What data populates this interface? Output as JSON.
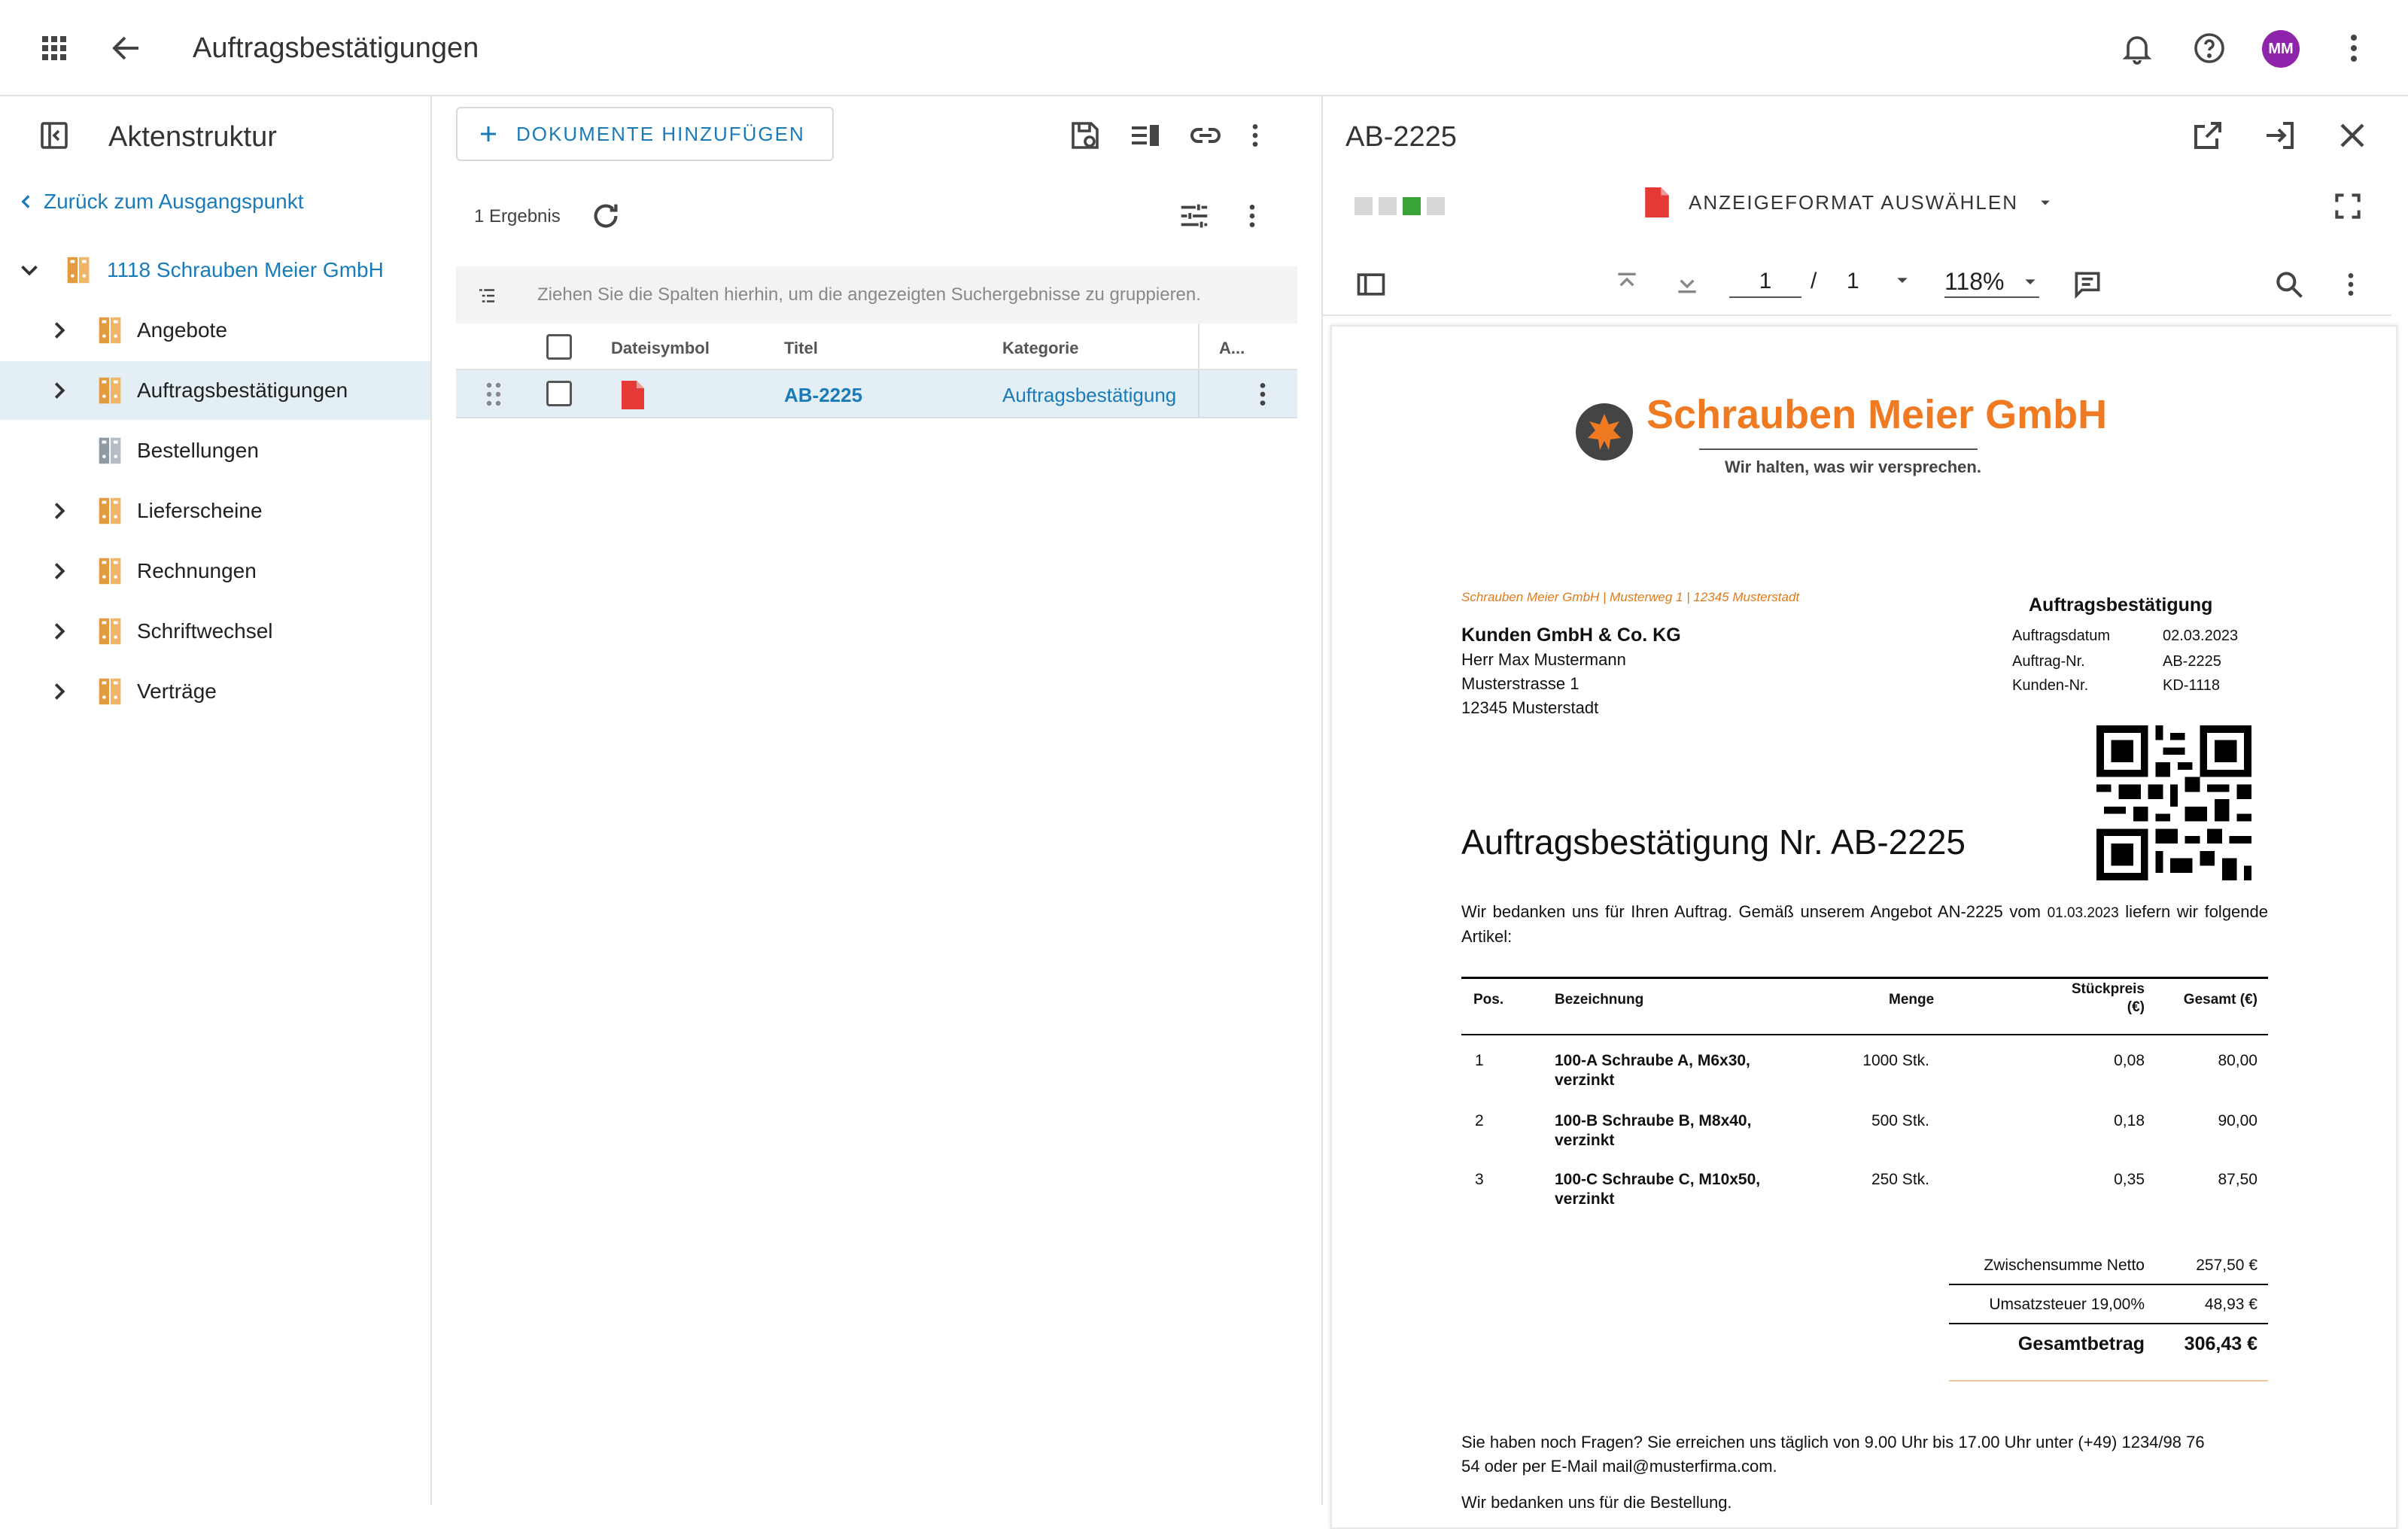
{
  "appbar": {
    "title": "Auftragsbestätigungen",
    "avatar": "MM",
    "avatar_color": "#8e24aa"
  },
  "sidebar": {
    "title": "Aktenstruktur",
    "back_link": "Zurück zum Ausgangspunkt",
    "root": "1118 Schrauben Meier GmbH",
    "items": [
      {
        "label": "Angebote",
        "expandable": true
      },
      {
        "label": "Auftragsbestätigungen",
        "expandable": true,
        "selected": true
      },
      {
        "label": "Bestellungen",
        "expandable": false
      },
      {
        "label": "Lieferscheine",
        "expandable": true
      },
      {
        "label": "Rechnungen",
        "expandable": true
      },
      {
        "label": "Schriftwechsel",
        "expandable": true
      },
      {
        "label": "Verträge",
        "expandable": true
      }
    ]
  },
  "middle": {
    "add_button": "DOKUMENTE HINZUFÜGEN",
    "result_count": "1 Ergebnis",
    "group_hint": "Ziehen Sie die Spalten hierhin, um die angezeigten Suchergebnisse zu gruppieren.",
    "columns": [
      "Dateisymbol",
      "Titel",
      "Kategorie",
      "A..."
    ],
    "rows": [
      {
        "icon": "PDF",
        "title": "AB-2225",
        "category": "Auftragsbestätigung"
      }
    ]
  },
  "viewer": {
    "title": "AB-2225",
    "format_button": "ANZEIGEFORMAT AUSWÄHLEN",
    "page_current": "1",
    "page_sep": "/",
    "page_total": "1",
    "zoom": "118%"
  },
  "document": {
    "company": "Schrauben Meier GmbH",
    "slogan": "Wir halten, was wir versprechen.",
    "sender_line": "Schrauben Meier GmbH | Musterweg 1 | 12345 Musterstadt",
    "recipient": [
      "Kunden GmbH & Co. KG",
      "Herr Max Mustermann",
      "Musterstrasse 1",
      "12345 Musterstadt"
    ],
    "info_title": "Auftragsbestätigung",
    "info": [
      {
        "label": "Auftragsdatum",
        "value": "02.03.2023"
      },
      {
        "label": "Auftrag-Nr.",
        "value": "AB-2225"
      },
      {
        "label": "Kunden-Nr.",
        "value": "KD-1118"
      }
    ],
    "heading": "Auftragsbestätigung Nr. AB-2225",
    "intro_a": "Wir bedanken uns für Ihren Auftrag. Gemäß unserem Angebot AN-2225 vom",
    "intro_date": "01.03.2023",
    "intro_b": "liefern wir folgende Artikel:",
    "table_headers": {
      "pos": "Pos.",
      "desc": "Bezeichnung",
      "qty": "Menge",
      "unit_a": "Stückpreis",
      "unit_b": "(€)",
      "total": "Gesamt (€)"
    },
    "items": [
      {
        "pos": "1",
        "desc_a": "100-A Schraube A, M6x30,",
        "desc_b": "verzinkt",
        "qty": "1000 Stk.",
        "unit": "0,08",
        "total": "80,00"
      },
      {
        "pos": "2",
        "desc_a": "100-B Schraube B, M8x40,",
        "desc_b": "verzinkt",
        "qty": "500 Stk.",
        "unit": "0,18",
        "total": "90,00"
      },
      {
        "pos": "3",
        "desc_a": "100-C Schraube C, M10x50,",
        "desc_b": "verzinkt",
        "qty": "250 Stk.",
        "unit": "0,35",
        "total": "87,50"
      }
    ],
    "subtotal_label": "Zwischensumme Netto",
    "subtotal": "257,50 €",
    "vat_label": "Umsatzsteuer 19,00%",
    "vat": "48,93 €",
    "total_label": "Gesamtbetrag",
    "total": "306,43 €",
    "footer_a": "Sie haben noch Fragen? Sie erreichen uns täglich von 9.00 Uhr bis 17.00 Uhr unter (+49) 1234/98 76",
    "footer_b": "54 oder per E-Mail mail@musterfirma.com.",
    "footer_c": "Wir bedanken uns für die Bestellung."
  },
  "colors": {
    "accent": "#1a7bb9",
    "folder": "#e39b3f",
    "selected_row": "#e4eef5",
    "brand_orange": "#f07a22",
    "pdf_red": "#e53935"
  }
}
